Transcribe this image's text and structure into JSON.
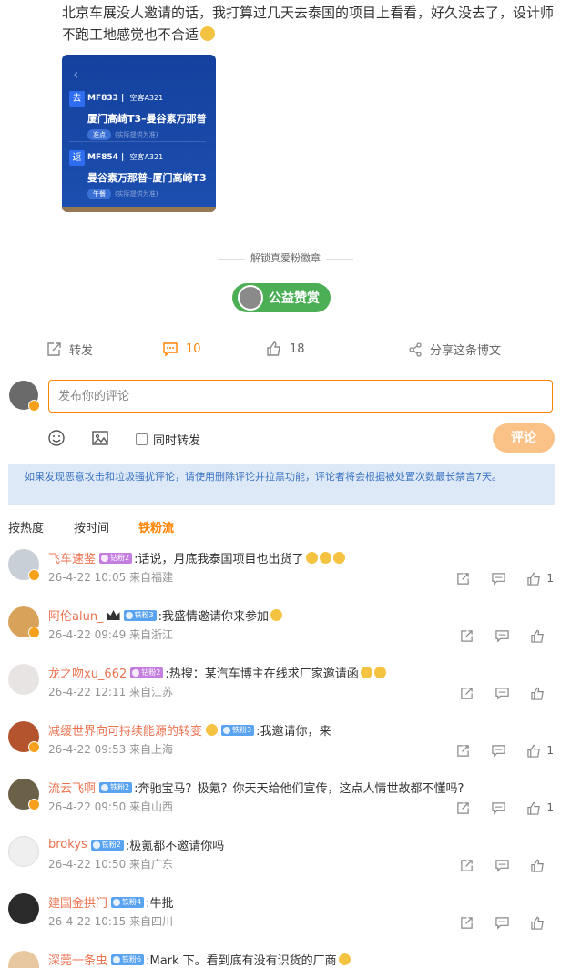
{
  "post": {
    "text": "北京车展没人邀请的话，我打算过几天去泰国的项目上看看，好久没去了，设计师不跑工地感觉也不合适",
    "image": {
      "outbound": {
        "tag": "去",
        "flight": "MF833",
        "aircraft": "空客A321",
        "route": "厦门高崎T3–曼谷素万那普",
        "pill": "准点",
        "note": "(实际提供为准)"
      },
      "inbound": {
        "tag": "返",
        "flight": "MF854",
        "aircraft": "空客A321",
        "route": "曼谷素万那普–厦门高崎T3",
        "pill": "午餐",
        "note": "(实际提供为准)"
      }
    },
    "unlock_label": "解锁真爱粉徽章",
    "reward_label": "公益赞赏"
  },
  "actions": {
    "repost": "转发",
    "comment_count": "10",
    "like_count": "18",
    "share": "分享这条博文"
  },
  "composer": {
    "placeholder": "发布你的评论",
    "repost_label": "同时转发",
    "submit": "评论"
  },
  "notice": "如果发现恶意攻击和垃圾骚扰评论，请使用删除评论并拉黑功能，评论者将会根据被处置次数最长禁言7天。",
  "sort": {
    "tabs": [
      "按热度",
      "按时间",
      "铁粉流"
    ],
    "active": "铁粉流"
  },
  "colors": {
    "accent": "#ff8200",
    "name": "#eb7350",
    "diamond_badge": "#c47ee0",
    "iron_badge": "#5aa3f0",
    "reward": "#4cae55"
  },
  "comments": [
    {
      "name": "飞车速鉴",
      "badge": "钻粉2",
      "text": ":话说，月底我泰国项目也出货了",
      "meta": "26-4-22 10:05 来自福建",
      "likes": "1"
    },
    {
      "name": "阿伦alun_",
      "badge": "铁粉3",
      "text": ":我盛情邀请你来参加",
      "meta": "26-4-22 09:49 来自浙江",
      "likes": ""
    },
    {
      "name": "龙之吻xu_662",
      "badge": "钻粉2",
      "text": ":热搜：某汽车博主在线求厂家邀请函",
      "meta": "26-4-22 12:11 来自江苏",
      "likes": ""
    },
    {
      "name": "减缓世界向可持续能源的转变",
      "badge": "铁粉3",
      "text": ":我邀请你，来",
      "meta": "26-4-22 09:53 来自上海",
      "likes": "1"
    },
    {
      "name": "流云飞啊",
      "badge": "铁粉2",
      "text": ":奔驰宝马？极氪？你天天给他们宣传，这点人情世故都不懂吗?",
      "meta": "26-4-22 09:50 来自山西",
      "likes": "1"
    },
    {
      "name": "brokys",
      "badge": "铁粉2",
      "text": ":极氪都不邀请你吗",
      "meta": "26-4-22 10:50 来自广东",
      "likes": ""
    },
    {
      "name": "建国金拱门",
      "badge": "铁粉4",
      "text": ":牛批",
      "meta": "26-4-22 10:15 来自四川",
      "likes": ""
    },
    {
      "name": "深莞一条虫",
      "badge": "铁粉6",
      "text": ":Mark 下。看到底有没有识货的厂商",
      "meta": "",
      "likes": ""
    }
  ]
}
